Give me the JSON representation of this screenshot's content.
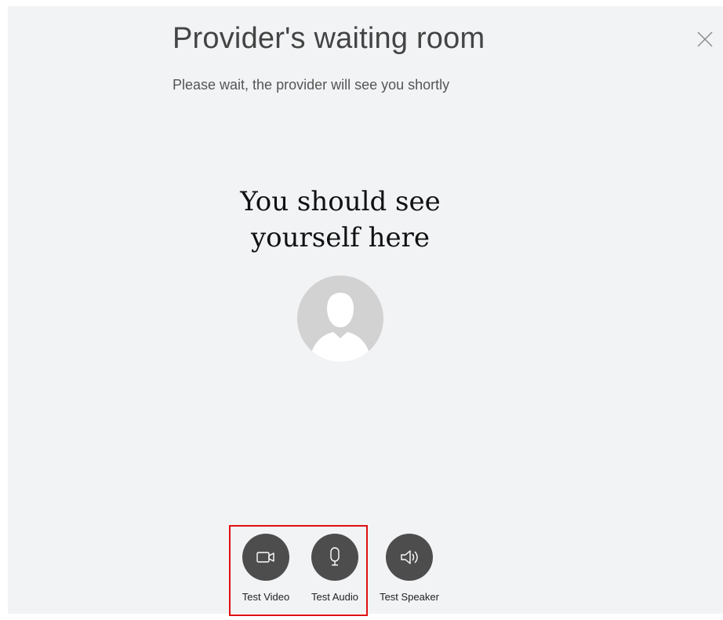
{
  "header": {
    "title": "Provider's waiting room",
    "subtitle": "Please wait, the provider will see you shortly",
    "close_icon": "close-icon"
  },
  "self_view": {
    "line1": "You should see",
    "line2": "yourself here",
    "avatar_icon": "person-placeholder-icon"
  },
  "controls": [
    {
      "label": "Test Video",
      "icon": "camera-icon"
    },
    {
      "label": "Test Audio",
      "icon": "microphone-icon"
    },
    {
      "label": "Test Speaker",
      "icon": "speaker-icon"
    }
  ],
  "colors": {
    "background": "#f2f3f5",
    "control_button": "#4d4d4d",
    "highlight": "#e01010",
    "avatar": "#d2d2d2"
  }
}
